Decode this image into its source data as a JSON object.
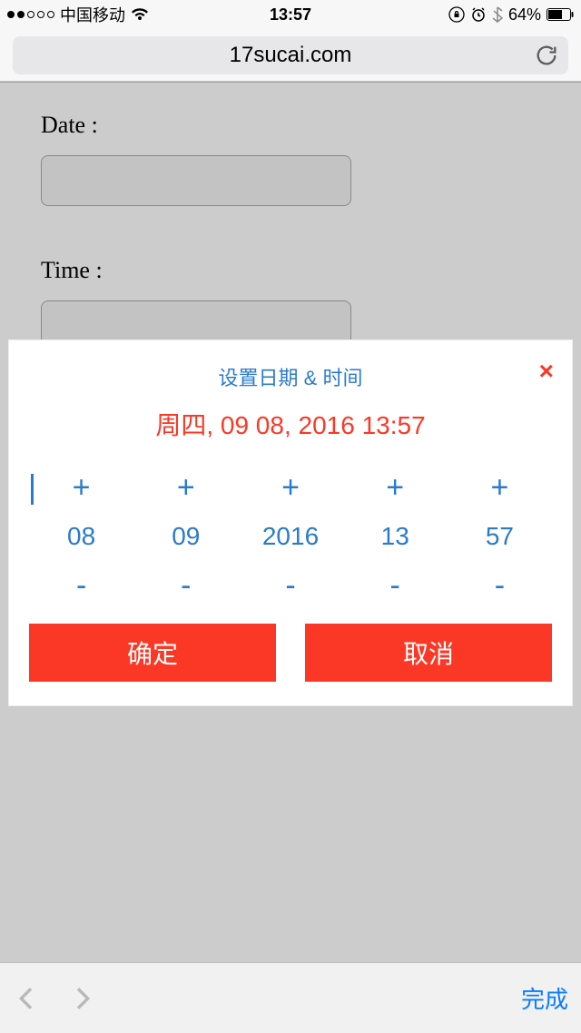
{
  "status": {
    "carrier": "中国移动",
    "time": "13:57",
    "battery_pct": "64%"
  },
  "url_bar": {
    "url": "17sucai.com"
  },
  "form": {
    "date_label": "Date :",
    "date_value": "",
    "time_label": "Time :",
    "time_value": ""
  },
  "modal": {
    "title": "设置日期 & 时间",
    "close": "×",
    "date_display": "周四, 09 08, 2016 13:57",
    "columns": [
      {
        "value": "08"
      },
      {
        "value": "09"
      },
      {
        "value": "2016"
      },
      {
        "value": "13"
      },
      {
        "value": "57"
      }
    ],
    "plus": "+",
    "minus": "-",
    "confirm": "确定",
    "cancel": "取消"
  },
  "bottom": {
    "done": "完成"
  }
}
